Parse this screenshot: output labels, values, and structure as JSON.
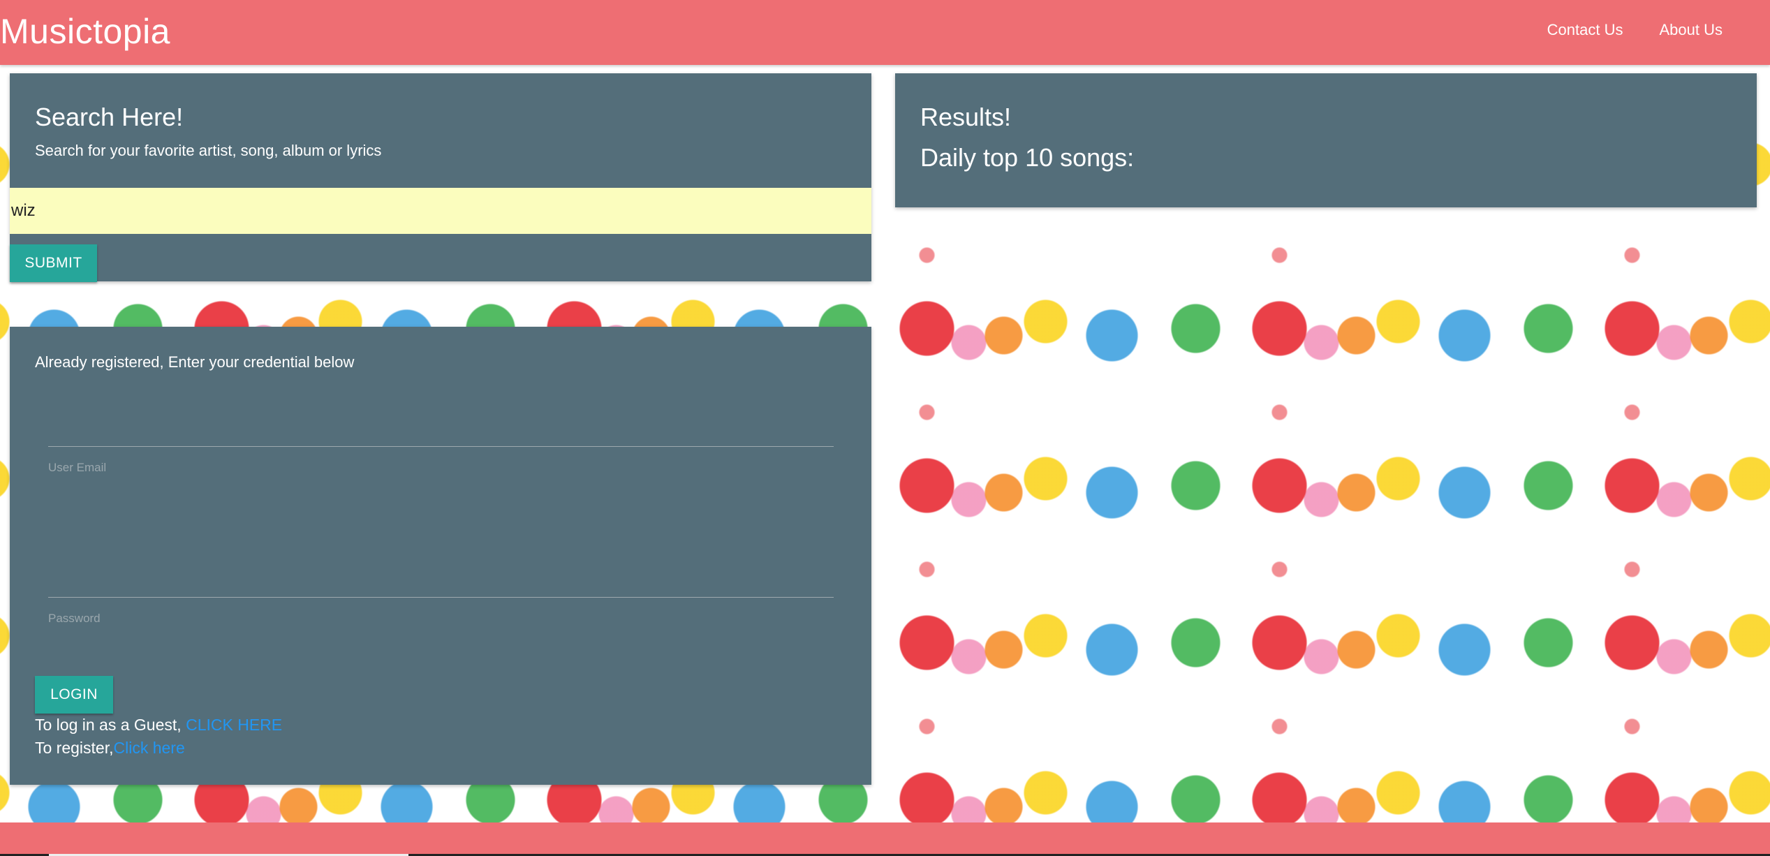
{
  "header": {
    "brand": "Musictopia",
    "nav": [
      "Contact Us",
      "About Us"
    ]
  },
  "search": {
    "title": "Search Here!",
    "subtitle": "Search for your favorite artist, song, album or lyrics",
    "value": "wiz",
    "submit_label": "SUBMIT"
  },
  "results": {
    "title": "Results!",
    "subtitle": "Daily top 10 songs:"
  },
  "login": {
    "heading": "Already registered, Enter your credential below",
    "email_label": "User Email",
    "password_label": "Password",
    "login_label": "LOGIN",
    "guest_text": "To log in as a Guest, ",
    "guest_link": "CLICK HERE",
    "register_text": "To register,",
    "register_link": "Click here"
  },
  "colors": {
    "navbar": "#ee6e73",
    "card": "#546e7a",
    "button": "#26a69a",
    "search_input": "#fbfdbe",
    "link": "#2196f3"
  }
}
